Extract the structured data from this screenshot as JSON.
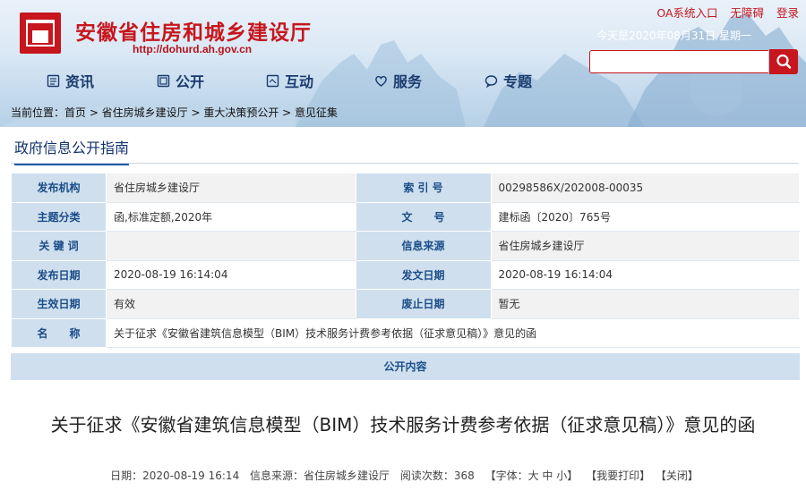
{
  "header": {
    "site_title": "安徽省住房和城乡建设厅",
    "site_url": "http://dohurd.ah.gov.cn",
    "top_links": [
      "OA系统入口",
      "无障碍",
      "登录"
    ],
    "date_text": "今天是2020年08月31日 星期一",
    "search_placeholder": "",
    "accent_color": "#c7161d"
  },
  "nav": [
    {
      "label": "资讯",
      "icon": "document-list-icon"
    },
    {
      "label": "公开",
      "icon": "open-folder-icon"
    },
    {
      "label": "互动",
      "icon": "interaction-icon"
    },
    {
      "label": "服务",
      "icon": "heart-icon"
    },
    {
      "label": "专题",
      "icon": "chat-bubble-icon"
    }
  ],
  "breadcrumb": "当前位置：首页 > 省住房城乡建设厅 > 重大决策预公开 > 意见征集",
  "guide_title": "政府信息公开指南",
  "meta": {
    "row1": {
      "l1": "发布机构",
      "v1": "省住房城乡建设厅",
      "l2": "索 引 号",
      "v2": "00298586X/202008-00035"
    },
    "row2": {
      "l1": "主题分类",
      "v1": "函,标准定额,2020年",
      "l2": "文　　号",
      "v2": "建标函〔2020〕765号"
    },
    "row3": {
      "l1": "关 键 词",
      "v1": "",
      "l2": "信息来源",
      "v2": "省住房城乡建设厅"
    },
    "row4": {
      "l1": "发布日期",
      "v1": "2020-08-19 16:14:04",
      "l2": "发文日期",
      "v2": "2020-08-19 16:14:04"
    },
    "row5": {
      "l1": "生效日期",
      "v1": "有效",
      "l2": "废止日期",
      "v2": "暂无"
    },
    "row6": {
      "l1": "名　　称",
      "v1": "关于征求《安徽省建筑信息模型（BIM）技术服务计费参考依据（征求意见稿）》意见的函"
    }
  },
  "open_content": "公开内容",
  "article": {
    "title": "关于征求《安徽省建筑信息模型（BIM）技术服务计费参考依据（征求意见稿）》意见的函",
    "date": "日期：2020-08-19 16:14",
    "source": "信息来源：省住房城乡建设厅",
    "reads": "阅读次数：368",
    "font_size": "【字体：大 中 小】",
    "print": "【我要打印】",
    "close": "【关闭】"
  }
}
